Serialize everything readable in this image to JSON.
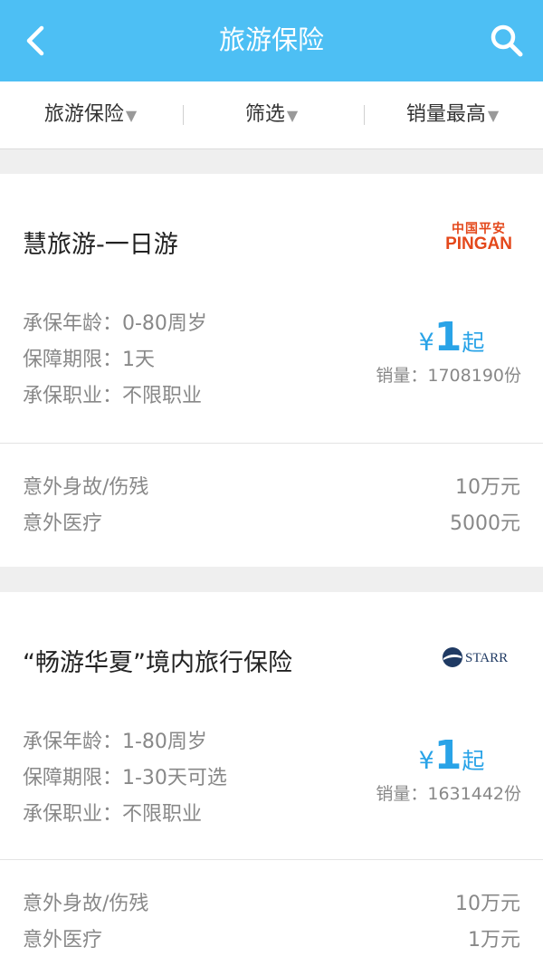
{
  "header": {
    "title": "旅游保险"
  },
  "filters": [
    {
      "label": "旅游保险"
    },
    {
      "label": "筛选"
    },
    {
      "label": "销量最高"
    }
  ],
  "products": [
    {
      "name": "慧旅游-一日游",
      "insurer_logo": {
        "cn": "中国平安",
        "en": "PINGAN"
      },
      "attrs": [
        "承保年龄：0-80周岁",
        "保障期限：1天",
        "承保职业：不限职业"
      ],
      "price_symbol": "¥",
      "price": "1",
      "price_suffix": "起",
      "sales": "销量：1708190份",
      "coverage": [
        {
          "label": "意外身故/伤残",
          "value": "10万元"
        },
        {
          "label": "意外医疗",
          "value": "5000元"
        }
      ]
    },
    {
      "name": "“畅游华夏”境内旅行保险",
      "insurer_logo": {
        "en": "STARR"
      },
      "attrs": [
        "承保年龄：1-80周岁",
        "保障期限：1-30天可选",
        "承保职业：不限职业"
      ],
      "price_symbol": "¥",
      "price": "1",
      "price_suffix": "起",
      "sales": "销量：1631442份",
      "coverage": [
        {
          "label": "意外身故/伤残",
          "value": "10万元"
        },
        {
          "label": "意外医疗",
          "value": "1万元"
        }
      ]
    }
  ],
  "colors": {
    "header_bg": "#4dbff4",
    "price": "#29a3e7",
    "pingan_logo": "#e4481b",
    "starr_logo": "#1f3a63"
  }
}
